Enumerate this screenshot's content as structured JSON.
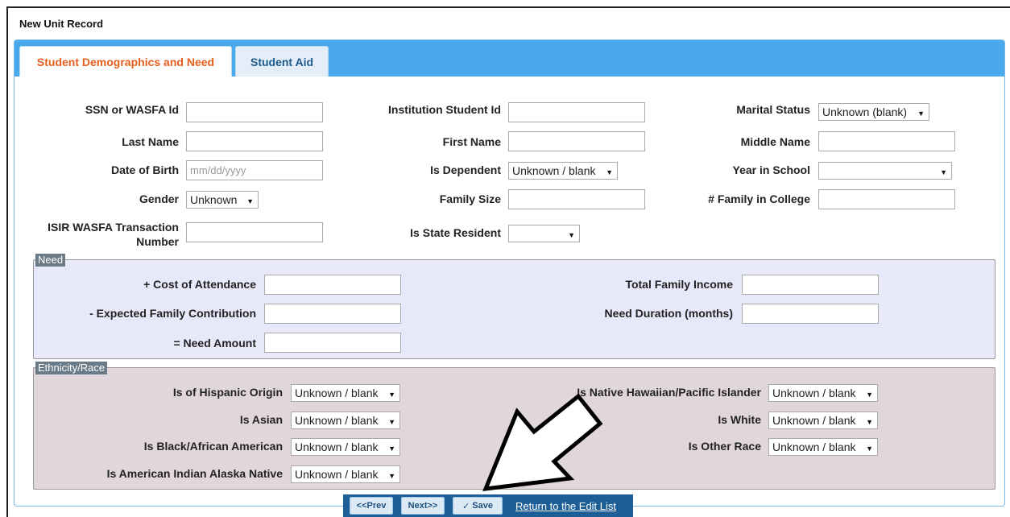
{
  "window": {
    "title": "New Unit Record"
  },
  "tabs": [
    {
      "label": "Student Demographics and Need",
      "active": true
    },
    {
      "label": "Student Aid",
      "active": false
    }
  ],
  "demographics": {
    "ssn": {
      "label": "SSN or WASFA Id",
      "value": ""
    },
    "institution_id": {
      "label": "Institution Student Id",
      "value": ""
    },
    "marital_status": {
      "label": "Marital Status",
      "value": "Unknown (blank)"
    },
    "last_name": {
      "label": "Last Name",
      "value": ""
    },
    "first_name": {
      "label": "First Name",
      "value": ""
    },
    "middle_name": {
      "label": "Middle Name",
      "value": ""
    },
    "dob": {
      "label": "Date of Birth",
      "placeholder": "mm/dd/yyyy",
      "value": ""
    },
    "is_dependent": {
      "label": "Is Dependent",
      "value": "Unknown / blank"
    },
    "year_in_school": {
      "label": "Year in School",
      "value": ""
    },
    "gender": {
      "label": "Gender",
      "value": "Unknown"
    },
    "family_size": {
      "label": "Family Size",
      "value": ""
    },
    "family_in_college": {
      "label": "# Family in College",
      "value": ""
    },
    "isir_line1": "ISIR WASFA Transaction",
    "isir_line2": "Number",
    "isir_value": "",
    "state_resident": {
      "label": "Is State Resident",
      "value": ""
    }
  },
  "need": {
    "legend": "Need",
    "cost_of_attendance": {
      "label": "+ Cost of Attendance",
      "value": ""
    },
    "total_family_income": {
      "label": "Total Family Income",
      "value": ""
    },
    "expected_family_contribution": {
      "label": "- Expected Family Contribution",
      "value": ""
    },
    "need_duration": {
      "label": "Need Duration (months)",
      "value": ""
    },
    "need_amount": {
      "label": "= Need Amount",
      "value": ""
    }
  },
  "ethnicity": {
    "legend": "Ethnicity/Race",
    "hispanic": {
      "label": "Is of Hispanic Origin",
      "value": "Unknown / blank"
    },
    "native_hawaiian": {
      "label": "Is Native Hawaiian/Pacific Islander",
      "value": "Unknown / blank"
    },
    "asian": {
      "label": "Is Asian",
      "value": "Unknown / blank"
    },
    "white": {
      "label": "Is White",
      "value": "Unknown / blank"
    },
    "black": {
      "label": "Is Black/African American",
      "value": "Unknown / blank"
    },
    "other_race": {
      "label": "Is Other Race",
      "value": "Unknown / blank"
    },
    "american_indian": {
      "label": "Is American Indian Alaska Native",
      "value": "Unknown / blank"
    }
  },
  "footer": {
    "prev_label": "<<Prev",
    "next_label": "Next>>",
    "save_label": "Save",
    "save_icon": "checkmark-icon",
    "return_link": "Return to the Edit List"
  },
  "annotation": {
    "icon": "arrow-pointer-icon",
    "color": "#ffffff"
  }
}
